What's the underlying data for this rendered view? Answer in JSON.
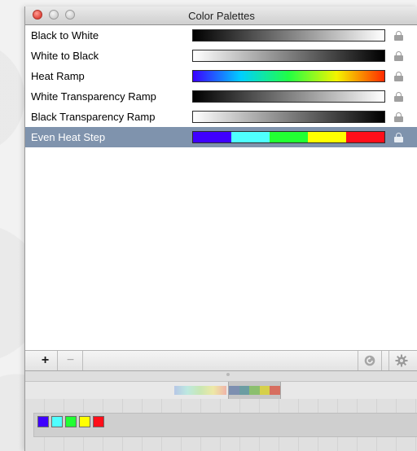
{
  "window": {
    "title": "Color Palettes"
  },
  "palettes": [
    {
      "name": "Black to White",
      "kind": "gradient",
      "colors": [
        "#000000",
        "#ffffff"
      ],
      "selected": false
    },
    {
      "name": "White to Black",
      "kind": "gradient",
      "colors": [
        "#ffffff",
        "#000000"
      ],
      "selected": false
    },
    {
      "name": "Heat Ramp",
      "kind": "gradient",
      "colors": [
        "#3a00ff",
        "#00cfff",
        "#21ff44",
        "#f4f400",
        "#ff2a00"
      ],
      "selected": false
    },
    {
      "name": "White Transparency Ramp",
      "kind": "gradient",
      "colors": [
        "#000000",
        "#ffffff"
      ],
      "selected": false
    },
    {
      "name": "Black Transparency Ramp",
      "kind": "gradient",
      "colors": [
        "#ffffff",
        "#000000"
      ],
      "selected": false
    },
    {
      "name": "Even Heat Step",
      "kind": "step",
      "colors": [
        "#3f00ff",
        "#4fffff",
        "#22ff33",
        "#ffff00",
        "#ff0e1a"
      ],
      "selected": true
    }
  ],
  "toolbar": {
    "add_label": "+",
    "remove_label": "−",
    "refresh_icon": "refresh-icon",
    "gear_icon": "gear-icon"
  },
  "editor": {
    "thumbnail_colors": [
      "#7d8fb0",
      "#6b9da2",
      "#8bbf6e",
      "#d6d04a",
      "#d76e5f"
    ],
    "stop_colors": [
      "#3f00ff",
      "#4fffff",
      "#22ff33",
      "#ffff00",
      "#ff0e1a"
    ]
  }
}
